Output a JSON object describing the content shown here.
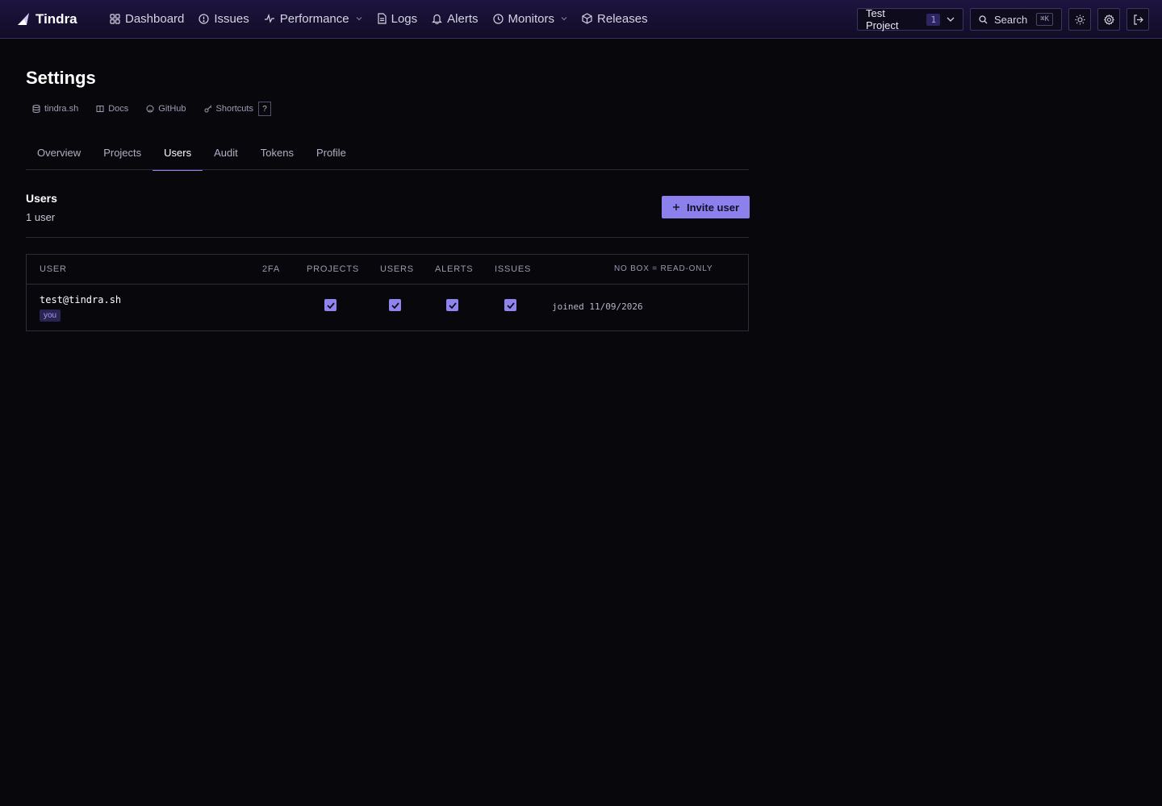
{
  "app": {
    "brand_name": "Tindra",
    "accent_color": "#8f84ee"
  },
  "nav": {
    "items": [
      {
        "label": "Dashboard",
        "icon": "grid-icon"
      },
      {
        "label": "Issues",
        "icon": "alert-circle-icon"
      },
      {
        "label": "Performance",
        "icon": "activity-icon",
        "has_dropdown": true
      },
      {
        "label": "Logs",
        "icon": "file-text-icon"
      },
      {
        "label": "Alerts",
        "icon": "bell-icon"
      },
      {
        "label": "Monitors",
        "icon": "clock-icon",
        "has_dropdown": true
      },
      {
        "label": "Releases",
        "icon": "package-icon"
      }
    ]
  },
  "header": {
    "project_name": "Test Project",
    "project_count": "1",
    "search_label": "Search",
    "search_shortcut": "⌘K"
  },
  "page": {
    "title": "Settings",
    "quick_links": [
      {
        "label": "tindra.sh",
        "icon": "database-icon"
      },
      {
        "label": "Docs",
        "icon": "book-icon"
      },
      {
        "label": "GitHub",
        "icon": "github-icon"
      },
      {
        "label": "Shortcuts",
        "icon": "key-icon"
      }
    ],
    "shortcut_key": "?"
  },
  "tabs": {
    "items": [
      "Overview",
      "Projects",
      "Users",
      "Audit",
      "Tokens",
      "Profile"
    ],
    "active": "Users"
  },
  "users_section": {
    "title": "Users",
    "count_label": "1 user",
    "invite_label": "Invite user"
  },
  "table": {
    "headers": {
      "user": "USER",
      "twofa": "2FA",
      "projects": "PROJECTS",
      "users": "USERS",
      "alerts": "ALERTS",
      "issues": "ISSUES",
      "note": "NO BOX = READ-ONLY"
    },
    "rows": [
      {
        "email": "test@tindra.sh",
        "badge": "you",
        "twofa": "",
        "projects": true,
        "users": true,
        "alerts": true,
        "issues": true,
        "joined": "joined 11/09/2026"
      }
    ]
  }
}
